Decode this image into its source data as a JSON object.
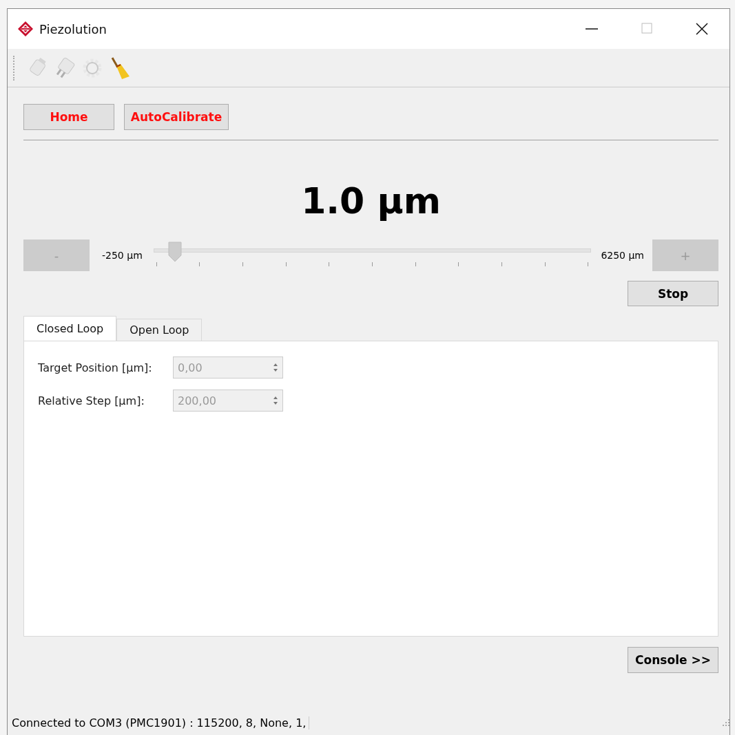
{
  "window": {
    "title": "Piezolution"
  },
  "toolbar": [
    {
      "kind": "plug",
      "disabled": true
    },
    {
      "kind": "connector",
      "disabled": true
    },
    {
      "kind": "gear",
      "disabled": true
    },
    {
      "kind": "broom",
      "disabled": false
    }
  ],
  "actions": [
    {
      "label": "Home",
      "highlight": true
    },
    {
      "label": "AutoCalibrate",
      "highlight": true
    }
  ],
  "position": "1.0 µm",
  "slider": {
    "minus": {
      "label": "-",
      "disabled": true
    },
    "min_label": "-250 µm",
    "level": 0.04,
    "max_label": "6250 µm",
    "plus": {
      "label": "+",
      "disabled": true
    }
  },
  "stop": {
    "label": "Stop"
  },
  "tabs": [
    {
      "label": "Closed Loop",
      "selected": true
    },
    {
      "label": "Open Loop",
      "selected": false
    }
  ],
  "fields": [
    {
      "label": "Target Position [µm]:",
      "value": "0,00",
      "disabled": true
    },
    {
      "label": "Relative Step [µm]:",
      "value": "200,00",
      "disabled": true
    }
  ],
  "console": {
    "label": "Console >>"
  },
  "status_bar": "Connected to COM3 (PMC1901) : 115200, 8, None, 1,"
}
